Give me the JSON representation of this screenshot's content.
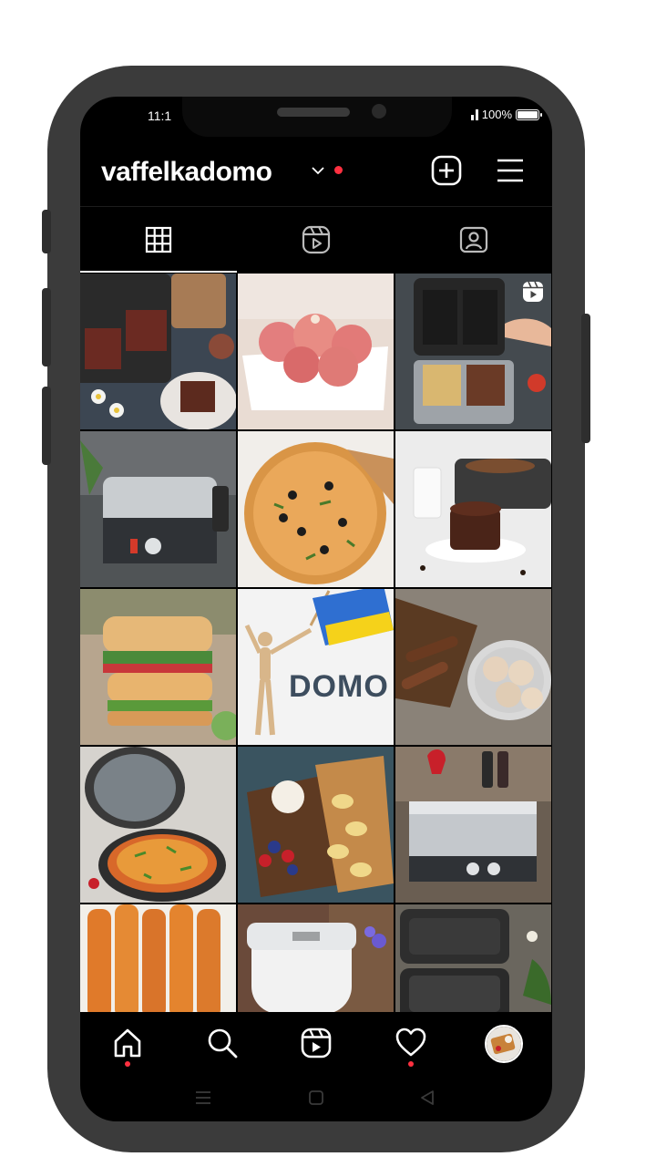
{
  "status_bar": {
    "time": "11:1",
    "battery": "100%"
  },
  "profile": {
    "username": "vaffelkadomo",
    "has_notification_dot": true
  },
  "tabs": [
    {
      "name": "posts-grid",
      "icon": "grid-icon",
      "active": true
    },
    {
      "name": "reels",
      "icon": "reels-icon",
      "active": false
    },
    {
      "name": "tagged",
      "icon": "tagged-user-icon",
      "active": false
    }
  ],
  "grid_posts": [
    {
      "subject": "chocolate waffles in waffle maker with daisies",
      "is_reel": false
    },
    {
      "subject": "pink ice cream scoops in white dish",
      "is_reel": false
    },
    {
      "subject": "waffle maker with chocolate waffles",
      "is_reel": true
    },
    {
      "subject": "DOMO contact grill",
      "is_reel": false
    },
    {
      "subject": "pizza with olives",
      "is_reel": false
    },
    {
      "subject": "chocolate pancake stack",
      "is_reel": false
    },
    {
      "subject": "grilled sandwiches",
      "is_reel": false
    },
    {
      "subject": "wooden mannequin with Ukrainian flag",
      "is_reel": false,
      "text": "DOMO"
    },
    {
      "subject": "ice cream scoops in bowl",
      "is_reel": false
    },
    {
      "subject": "pizza maker with pizza",
      "is_reel": false
    },
    {
      "subject": "waffles with banana and berries",
      "is_reel": false
    },
    {
      "subject": "contact grill with tulips",
      "is_reel": false
    },
    {
      "subject": "rolled fruit leather",
      "is_reel": false
    },
    {
      "subject": "ice cream maker",
      "is_reel": false
    },
    {
      "subject": "sandwich maker",
      "is_reel": false
    }
  ],
  "bottom_nav": [
    {
      "name": "home",
      "icon": "home-icon",
      "dot": true
    },
    {
      "name": "search",
      "icon": "search-icon",
      "dot": false
    },
    {
      "name": "reels",
      "icon": "reels-icon",
      "dot": false
    },
    {
      "name": "activity",
      "icon": "heart-icon",
      "dot": true
    },
    {
      "name": "profile",
      "icon": "avatar",
      "dot": false
    }
  ],
  "colors": {
    "background": "#000000",
    "notification_red": "#ff3040",
    "phone_frame": "#3b3b3b"
  }
}
